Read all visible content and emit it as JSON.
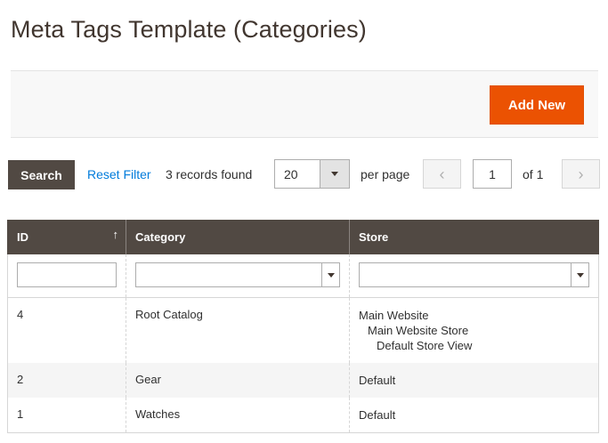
{
  "page": {
    "title": "Meta Tags Template (Categories)"
  },
  "actions": {
    "add_new_label": "Add New"
  },
  "toolbar": {
    "search_label": "Search",
    "reset_filter_label": "Reset Filter",
    "records_found": "3 records found",
    "page_size": "20",
    "per_page_label": "per page",
    "current_page": "1",
    "of_pages": "of 1",
    "prev_icon": "chevron-left-icon",
    "next_icon": "chevron-right-icon"
  },
  "grid": {
    "columns": [
      {
        "label": "ID",
        "sorted": "ascending"
      },
      {
        "label": "Category"
      },
      {
        "label": "Store"
      }
    ],
    "sort_icon": "↑",
    "filters": {
      "id": "",
      "category": "",
      "store": ""
    },
    "rows": [
      {
        "id": "4",
        "category": "Root Catalog",
        "store": [
          "Main Website",
          "Main Website Store",
          "Default Store View"
        ]
      },
      {
        "id": "2",
        "category": "Gear",
        "store": [
          "Default"
        ]
      },
      {
        "id": "1",
        "category": "Watches",
        "store": [
          "Default"
        ]
      }
    ]
  },
  "colors": {
    "accent": "#eb5202",
    "header": "#514943",
    "link": "#007bdb"
  }
}
